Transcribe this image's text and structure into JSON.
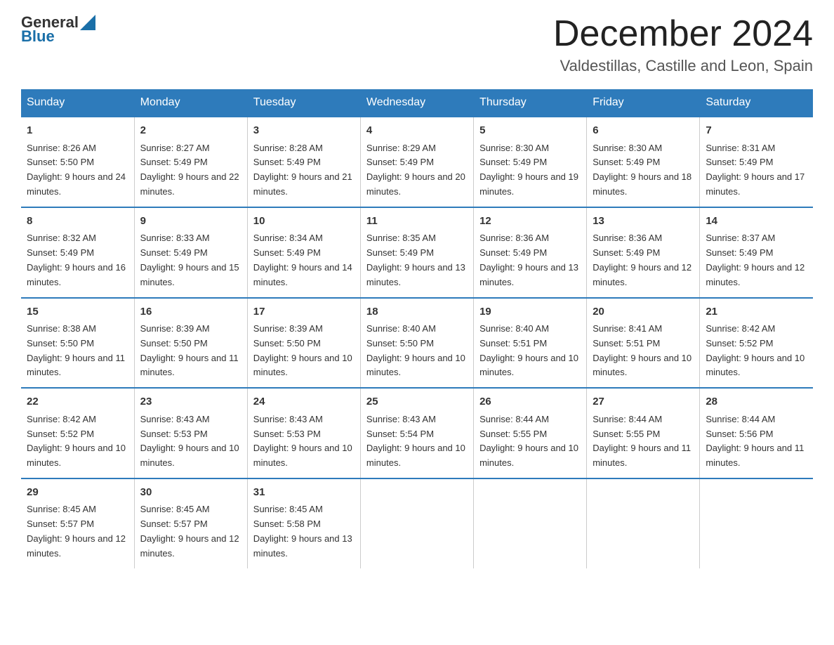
{
  "logo": {
    "text_general": "General",
    "text_blue": "Blue",
    "aria": "GeneralBlue Logo"
  },
  "header": {
    "month_year": "December 2024",
    "location": "Valdestillas, Castille and Leon, Spain"
  },
  "weekdays": [
    "Sunday",
    "Monday",
    "Tuesday",
    "Wednesday",
    "Thursday",
    "Friday",
    "Saturday"
  ],
  "weeks": [
    [
      {
        "day": "1",
        "sunrise": "Sunrise: 8:26 AM",
        "sunset": "Sunset: 5:50 PM",
        "daylight": "Daylight: 9 hours and 24 minutes."
      },
      {
        "day": "2",
        "sunrise": "Sunrise: 8:27 AM",
        "sunset": "Sunset: 5:49 PM",
        "daylight": "Daylight: 9 hours and 22 minutes."
      },
      {
        "day": "3",
        "sunrise": "Sunrise: 8:28 AM",
        "sunset": "Sunset: 5:49 PM",
        "daylight": "Daylight: 9 hours and 21 minutes."
      },
      {
        "day": "4",
        "sunrise": "Sunrise: 8:29 AM",
        "sunset": "Sunset: 5:49 PM",
        "daylight": "Daylight: 9 hours and 20 minutes."
      },
      {
        "day": "5",
        "sunrise": "Sunrise: 8:30 AM",
        "sunset": "Sunset: 5:49 PM",
        "daylight": "Daylight: 9 hours and 19 minutes."
      },
      {
        "day": "6",
        "sunrise": "Sunrise: 8:30 AM",
        "sunset": "Sunset: 5:49 PM",
        "daylight": "Daylight: 9 hours and 18 minutes."
      },
      {
        "day": "7",
        "sunrise": "Sunrise: 8:31 AM",
        "sunset": "Sunset: 5:49 PM",
        "daylight": "Daylight: 9 hours and 17 minutes."
      }
    ],
    [
      {
        "day": "8",
        "sunrise": "Sunrise: 8:32 AM",
        "sunset": "Sunset: 5:49 PM",
        "daylight": "Daylight: 9 hours and 16 minutes."
      },
      {
        "day": "9",
        "sunrise": "Sunrise: 8:33 AM",
        "sunset": "Sunset: 5:49 PM",
        "daylight": "Daylight: 9 hours and 15 minutes."
      },
      {
        "day": "10",
        "sunrise": "Sunrise: 8:34 AM",
        "sunset": "Sunset: 5:49 PM",
        "daylight": "Daylight: 9 hours and 14 minutes."
      },
      {
        "day": "11",
        "sunrise": "Sunrise: 8:35 AM",
        "sunset": "Sunset: 5:49 PM",
        "daylight": "Daylight: 9 hours and 13 minutes."
      },
      {
        "day": "12",
        "sunrise": "Sunrise: 8:36 AM",
        "sunset": "Sunset: 5:49 PM",
        "daylight": "Daylight: 9 hours and 13 minutes."
      },
      {
        "day": "13",
        "sunrise": "Sunrise: 8:36 AM",
        "sunset": "Sunset: 5:49 PM",
        "daylight": "Daylight: 9 hours and 12 minutes."
      },
      {
        "day": "14",
        "sunrise": "Sunrise: 8:37 AM",
        "sunset": "Sunset: 5:49 PM",
        "daylight": "Daylight: 9 hours and 12 minutes."
      }
    ],
    [
      {
        "day": "15",
        "sunrise": "Sunrise: 8:38 AM",
        "sunset": "Sunset: 5:50 PM",
        "daylight": "Daylight: 9 hours and 11 minutes."
      },
      {
        "day": "16",
        "sunrise": "Sunrise: 8:39 AM",
        "sunset": "Sunset: 5:50 PM",
        "daylight": "Daylight: 9 hours and 11 minutes."
      },
      {
        "day": "17",
        "sunrise": "Sunrise: 8:39 AM",
        "sunset": "Sunset: 5:50 PM",
        "daylight": "Daylight: 9 hours and 10 minutes."
      },
      {
        "day": "18",
        "sunrise": "Sunrise: 8:40 AM",
        "sunset": "Sunset: 5:50 PM",
        "daylight": "Daylight: 9 hours and 10 minutes."
      },
      {
        "day": "19",
        "sunrise": "Sunrise: 8:40 AM",
        "sunset": "Sunset: 5:51 PM",
        "daylight": "Daylight: 9 hours and 10 minutes."
      },
      {
        "day": "20",
        "sunrise": "Sunrise: 8:41 AM",
        "sunset": "Sunset: 5:51 PM",
        "daylight": "Daylight: 9 hours and 10 minutes."
      },
      {
        "day": "21",
        "sunrise": "Sunrise: 8:42 AM",
        "sunset": "Sunset: 5:52 PM",
        "daylight": "Daylight: 9 hours and 10 minutes."
      }
    ],
    [
      {
        "day": "22",
        "sunrise": "Sunrise: 8:42 AM",
        "sunset": "Sunset: 5:52 PM",
        "daylight": "Daylight: 9 hours and 10 minutes."
      },
      {
        "day": "23",
        "sunrise": "Sunrise: 8:43 AM",
        "sunset": "Sunset: 5:53 PM",
        "daylight": "Daylight: 9 hours and 10 minutes."
      },
      {
        "day": "24",
        "sunrise": "Sunrise: 8:43 AM",
        "sunset": "Sunset: 5:53 PM",
        "daylight": "Daylight: 9 hours and 10 minutes."
      },
      {
        "day": "25",
        "sunrise": "Sunrise: 8:43 AM",
        "sunset": "Sunset: 5:54 PM",
        "daylight": "Daylight: 9 hours and 10 minutes."
      },
      {
        "day": "26",
        "sunrise": "Sunrise: 8:44 AM",
        "sunset": "Sunset: 5:55 PM",
        "daylight": "Daylight: 9 hours and 10 minutes."
      },
      {
        "day": "27",
        "sunrise": "Sunrise: 8:44 AM",
        "sunset": "Sunset: 5:55 PM",
        "daylight": "Daylight: 9 hours and 11 minutes."
      },
      {
        "day": "28",
        "sunrise": "Sunrise: 8:44 AM",
        "sunset": "Sunset: 5:56 PM",
        "daylight": "Daylight: 9 hours and 11 minutes."
      }
    ],
    [
      {
        "day": "29",
        "sunrise": "Sunrise: 8:45 AM",
        "sunset": "Sunset: 5:57 PM",
        "daylight": "Daylight: 9 hours and 12 minutes."
      },
      {
        "day": "30",
        "sunrise": "Sunrise: 8:45 AM",
        "sunset": "Sunset: 5:57 PM",
        "daylight": "Daylight: 9 hours and 12 minutes."
      },
      {
        "day": "31",
        "sunrise": "Sunrise: 8:45 AM",
        "sunset": "Sunset: 5:58 PM",
        "daylight": "Daylight: 9 hours and 13 minutes."
      },
      null,
      null,
      null,
      null
    ]
  ]
}
